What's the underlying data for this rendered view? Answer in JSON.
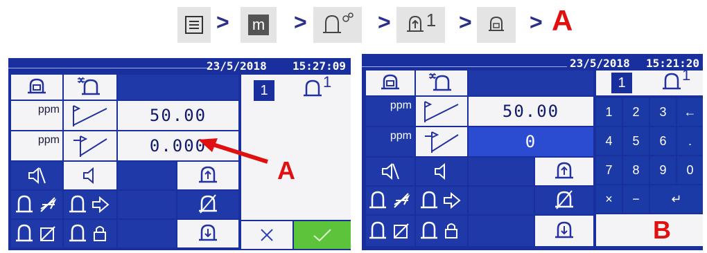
{
  "breadcrumb": {
    "icons": [
      "menu-icon",
      "m-icon",
      "alarm-settings-icon",
      "alarm-1-icon",
      "alarm-icon"
    ],
    "m_label": "m",
    "superscript": "1",
    "separator": ">",
    "target_letter": "A"
  },
  "screen_left": {
    "date": "23/5/2018",
    "time": "15:27:09",
    "alarm_number": "1",
    "alarm_superscript": "1",
    "rows": [
      {
        "unit": "ppm",
        "value": "50.00"
      },
      {
        "unit": "ppm",
        "value": "0.000"
      }
    ],
    "annotation": "A"
  },
  "screen_right": {
    "date": "23/5/2018",
    "time": "15:21:20",
    "alarm_number": "1",
    "alarm_superscript": "1",
    "rows": [
      {
        "unit": "ppm",
        "value": "50.00"
      },
      {
        "unit": "ppm",
        "value": "0"
      }
    ],
    "keypad": [
      "1",
      "2",
      "3",
      "←",
      "4",
      "5",
      "6",
      ".",
      "7",
      "8",
      "9",
      "0",
      "×",
      "−",
      "↵"
    ],
    "annotation": "B"
  },
  "colors": {
    "screen_blue": "#1a2f9e",
    "cell_white": "#f4f4f6",
    "confirm_green": "#5cc43a",
    "annotation_red": "#e01010",
    "arrow_navy": "#2a2e8c"
  }
}
